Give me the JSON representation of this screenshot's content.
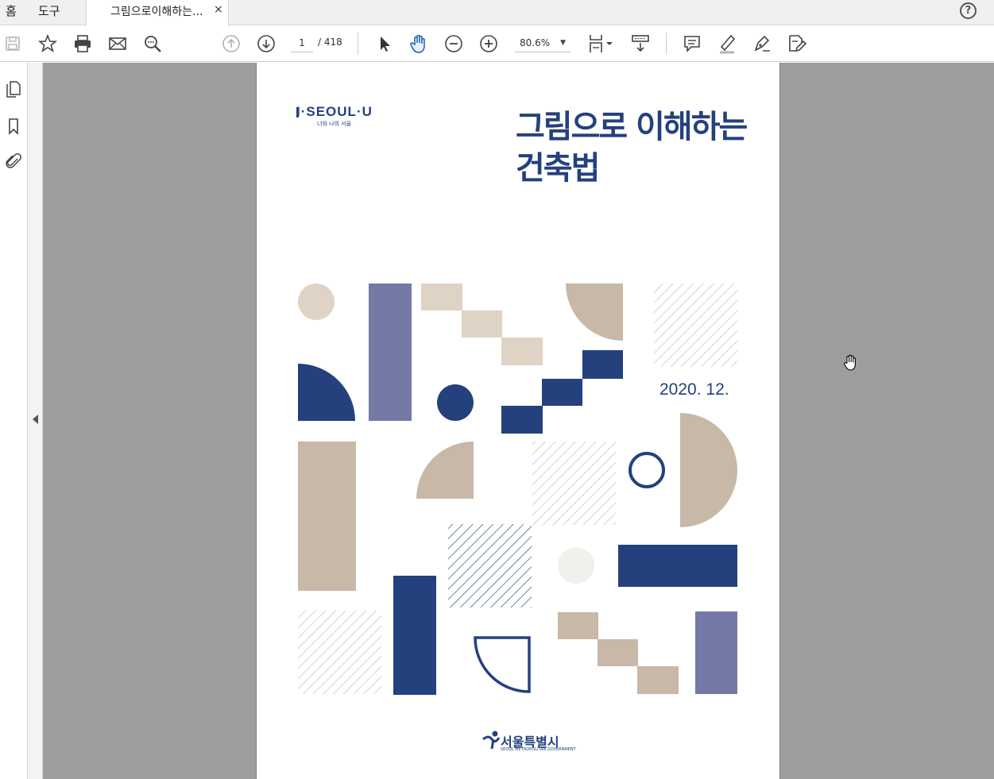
{
  "tabs": {
    "home": "홈",
    "tools": "도구",
    "document": "그림으로이해하는...",
    "close": "×",
    "help": "?"
  },
  "toolbar": {
    "current_page": "1",
    "page_total": "/ 418",
    "zoom": "80.6%",
    "zoom_caret": "▼",
    "icons": [
      "save-icon",
      "bookmark-star-icon",
      "print-icon",
      "email-icon",
      "search-icon",
      "page-up-icon",
      "page-down-icon",
      "select-cursor-icon",
      "hand-tool-icon",
      "zoom-out-icon",
      "zoom-in-icon",
      "fit-page-icon",
      "scroll-mode-icon",
      "comment-icon",
      "highlight-icon",
      "sign-icon",
      "fill-sign-icon"
    ]
  },
  "sidebar": {
    "icons": [
      "page-thumbnails-icon",
      "bookmarks-icon",
      "attachments-icon"
    ]
  },
  "document": {
    "logo": "I·SEOUL·U",
    "logo_sub": "너와 나의 서울",
    "title_line1": "그림으로 이해하는",
    "title_line2": "건축법",
    "date": "2020. 12.",
    "publisher": "서울특별시",
    "publisher_en": "SEOUL METROPOLITAN GOVERNMENT"
  },
  "colors": {
    "navy": "#24417e",
    "beige": "#c8b8a8",
    "light_beige": "#dfd3c6",
    "purple": "#7479a6",
    "cream": "#f2f0ec",
    "viewer_gray": "#9d9d9d"
  }
}
